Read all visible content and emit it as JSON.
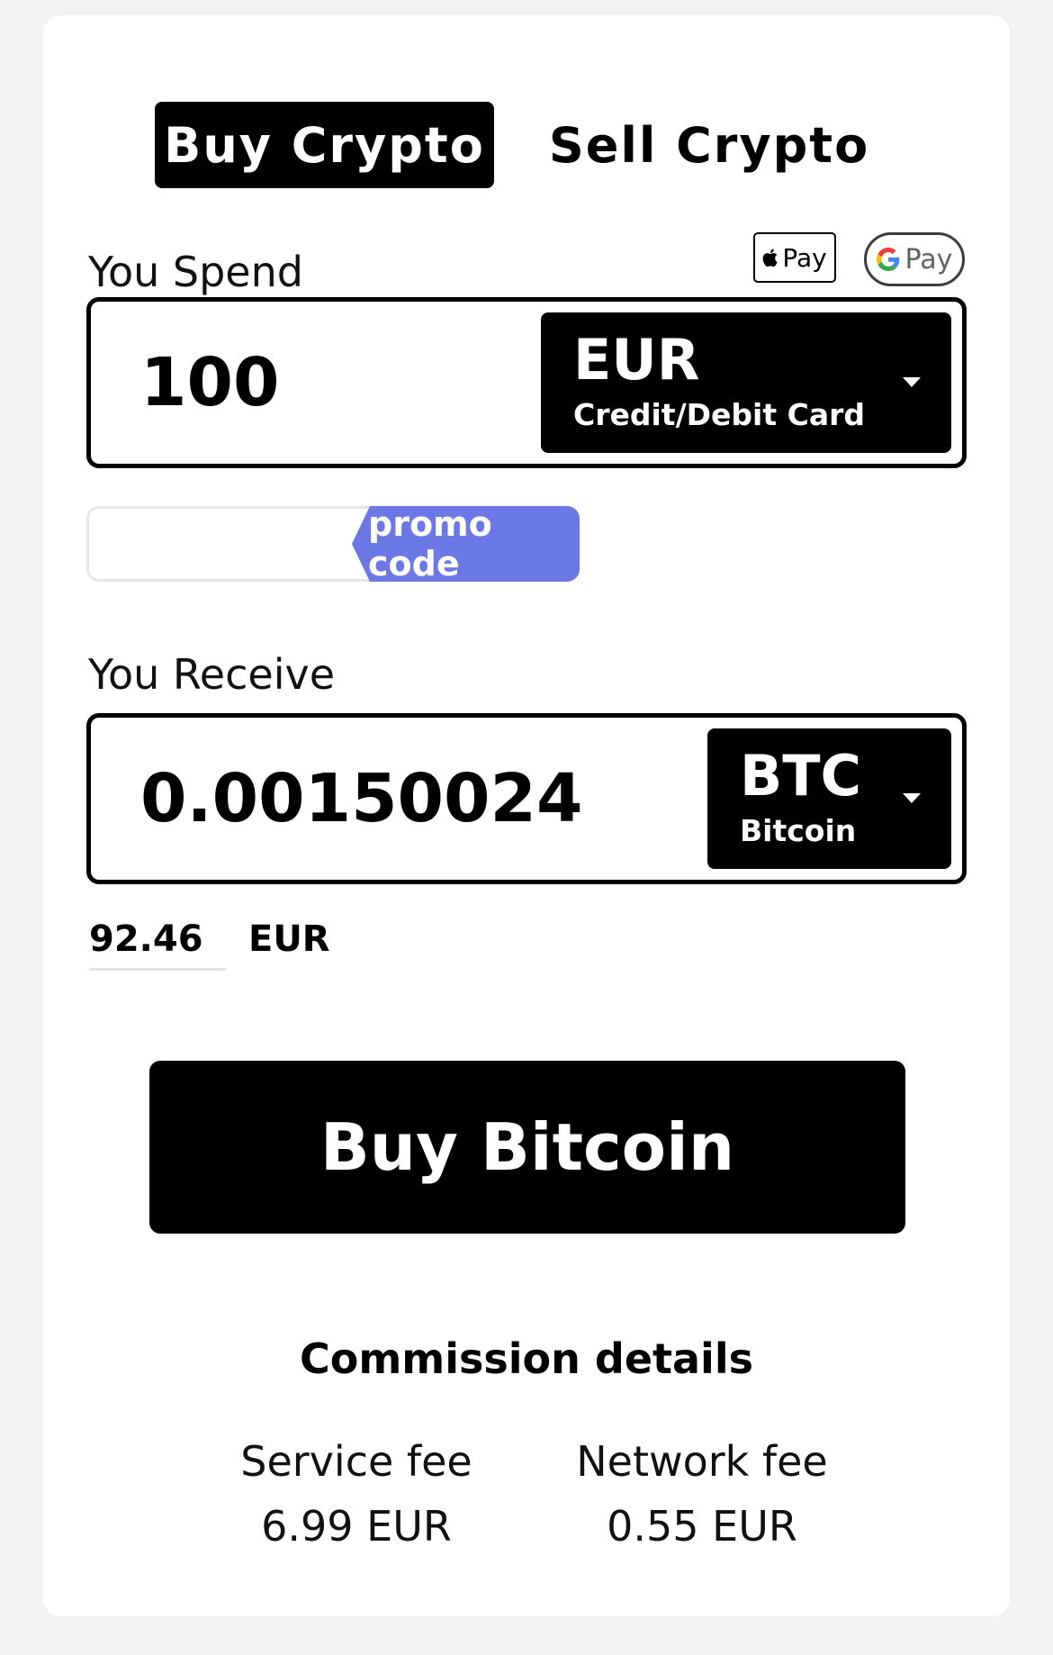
{
  "tabs": {
    "buy_label": "Buy Crypto",
    "sell_label": "Sell Crypto"
  },
  "spend": {
    "label": "You Spend",
    "amount": "100",
    "currency_code": "EUR",
    "payment_method": "Credit/Debit Card",
    "apple_pay_label": "Pay",
    "google_pay_label": "Pay"
  },
  "promo": {
    "button_label": "promo code",
    "value": ""
  },
  "receive": {
    "label": "You Receive",
    "amount": "0.00150024",
    "currency_code": "BTC",
    "currency_name": "Bitcoin"
  },
  "conversion": {
    "amount": "92.46",
    "currency": "EUR"
  },
  "action": {
    "buy_label": "Buy Bitcoin"
  },
  "commission": {
    "title": "Commission details",
    "service_fee_label": "Service fee",
    "service_fee_value": "6.99 EUR",
    "network_fee_label": "Network fee",
    "network_fee_value": "0.55 EUR"
  },
  "icons": {
    "apple": "apple-icon",
    "google": "google-g-icon",
    "caret": "caret-down-icon"
  },
  "colors": {
    "primary": "#000000",
    "promo": "#6b78e5",
    "background": "#f2f2f4",
    "card": "#ffffff"
  }
}
